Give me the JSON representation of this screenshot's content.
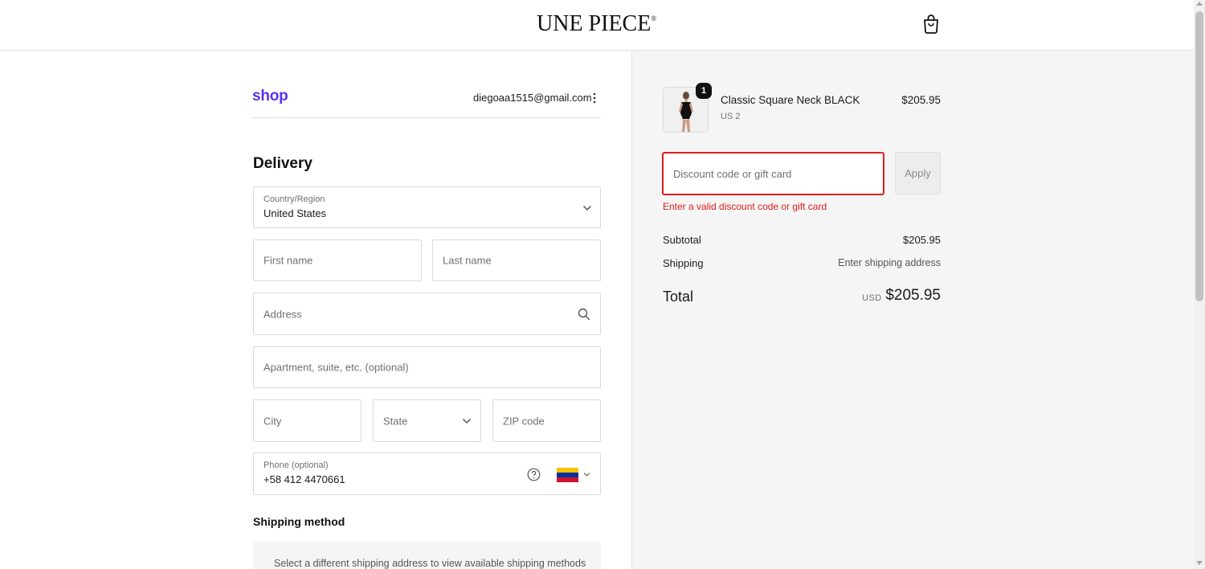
{
  "header": {
    "brand": "UNE PIECE",
    "brand_mark": "®",
    "cart_icon": "shopping-bag-icon"
  },
  "account": {
    "shop_logo": "shop",
    "email": "diegoaa1515@gmail.com",
    "menu_icon": "more-vertical-icon"
  },
  "delivery": {
    "heading": "Delivery",
    "country": {
      "label": "Country/Region",
      "value": "United States"
    },
    "first_name": {
      "placeholder": "First name"
    },
    "last_name": {
      "placeholder": "Last name"
    },
    "address": {
      "placeholder": "Address",
      "icon": "search-icon"
    },
    "apartment": {
      "placeholder": "Apartment, suite, etc. (optional)"
    },
    "city": {
      "placeholder": "City"
    },
    "state": {
      "placeholder": "State"
    },
    "zip": {
      "placeholder": "ZIP code"
    },
    "phone": {
      "label": "Phone (optional)",
      "value": "+58 412 4470661",
      "help_icon": "help-circle-icon",
      "flag": "venezuela-flag-icon"
    }
  },
  "shipping_method": {
    "heading": "Shipping method",
    "message": "Select a different shipping address to view available shipping methods"
  },
  "summary": {
    "item": {
      "quantity": "1",
      "name": "Classic Square Neck BLACK",
      "variant": "US 2",
      "price": "$205.95"
    },
    "discount": {
      "placeholder": "Discount code or gift card",
      "apply_label": "Apply",
      "error": "Enter a valid discount code or gift card"
    },
    "subtotal_label": "Subtotal",
    "subtotal_value": "$205.95",
    "shipping_label": "Shipping",
    "shipping_value": "Enter shipping address",
    "total_label": "Total",
    "total_currency": "USD",
    "total_value": "$205.95"
  },
  "colors": {
    "shop_purple": "#5a31f4",
    "error_red": "#dd1d1d",
    "summary_bg": "#f5f5f5"
  }
}
